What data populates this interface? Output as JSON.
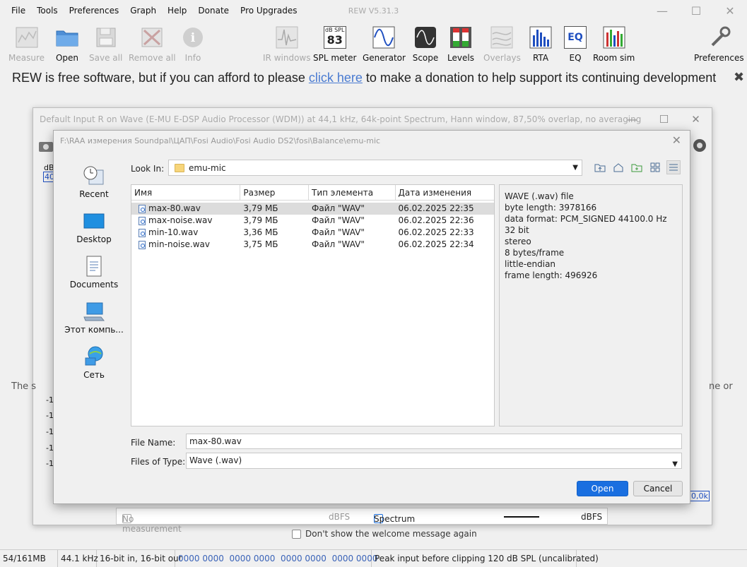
{
  "menu": [
    "File",
    "Tools",
    "Preferences",
    "Graph",
    "Help",
    "Donate",
    "Pro Upgrades"
  ],
  "app_title": "REW V5.31.3",
  "window_controls": [
    "—",
    "☐",
    "✕"
  ],
  "toolbar": {
    "measure": "Measure",
    "open": "Open",
    "save_all": "Save all",
    "remove_all": "Remove all",
    "info": "Info",
    "ir_windows": "IR windows",
    "spl_meter": "SPL meter",
    "spl_top": "dB SPL",
    "spl_value": "83",
    "generator": "Generator",
    "scope": "Scope",
    "levels": "Levels",
    "overlays": "Overlays",
    "rta": "RTA",
    "eq": "EQ",
    "eq_icon_text": "EQ",
    "room_sim": "Room sim",
    "preferences": "Preferences"
  },
  "donation": {
    "before": "REW is free software, but if you can afford to please ",
    "link": "click here",
    "after": " to make a donation to help support its continuing development",
    "close": "✖"
  },
  "bg_window": {
    "title": "Default Input R on Wave (E-MU E-DSP Audio Processor (WDM)) at 44,1 kHz, 64k-point Spectrum, Hann window, 87,50% overlap, no averaging",
    "controls": [
      "—",
      "☐",
      "✕"
    ],
    "db_label": "dB",
    "db_value": "40",
    "right_label": "0,0k",
    "status": {
      "no_measurement": "No measurement",
      "dbfs1": "dBFS",
      "spectrum": "Spectrum",
      "dbfs2": "dBFS"
    },
    "axis_ticks": [
      "-1",
      "-1",
      "-1",
      "-1",
      "-1"
    ]
  },
  "welcome_left": "The s",
  "welcome_right": "ne or",
  "dont_show": "Don't show the welcome message again",
  "dialog": {
    "title": "F:\\RAA измерения Soundpal\\ЦАП\\Fosi Audio\\Fosi Audio DS2\\fosi\\Balance\\emu-mic",
    "close": "✕",
    "places": [
      {
        "label": "Recent"
      },
      {
        "label": "Desktop"
      },
      {
        "label": "Documents"
      },
      {
        "label": "Этот компь..."
      },
      {
        "label": "Сеть"
      }
    ],
    "look_in_label": "Look In:",
    "look_in_value": "emu-mic",
    "columns": [
      "Имя",
      "Размер",
      "Тип элемента",
      "Дата изменения"
    ],
    "files": [
      {
        "name": "max-80.wav",
        "size": "3,79 МБ",
        "type": "Файл \"WAV\"",
        "date": "06.02.2025 22:35"
      },
      {
        "name": "max-noise.wav",
        "size": "3,79 МБ",
        "type": "Файл \"WAV\"",
        "date": "06.02.2025 22:36"
      },
      {
        "name": "min-10.wav",
        "size": "3,36 МБ",
        "type": "Файл \"WAV\"",
        "date": "06.02.2025 22:33"
      },
      {
        "name": "min-noise.wav",
        "size": "3,75 МБ",
        "type": "Файл \"WAV\"",
        "date": "06.02.2025 22:34"
      }
    ],
    "info": [
      "WAVE (.wav) file",
      "byte length: 3978166",
      "data format: PCM_SIGNED 44100.0 Hz",
      "32 bit",
      "stereo",
      "8 bytes/frame",
      "little-endian",
      "frame length: 496926"
    ],
    "file_name_label": "File Name:",
    "file_name_value": "max-80.wav",
    "files_of_type_label": "Files of Type:",
    "files_of_type_value": "Wave (.wav)",
    "open_button": "Open",
    "cancel_button": "Cancel"
  },
  "statusbar": {
    "memory": "54/161MB",
    "rate": "44.1 kHz",
    "bits": "16-bit in, 16-bit out",
    "hex": "0000 0000  0000 0000  0000 0000  0000 0000",
    "peak": "Peak input before clipping 120 dB SPL (uncalibrated)"
  },
  "colors": {
    "accent": "#1a6fe0",
    "link": "#4a7bd1",
    "disabled": "#a9a9a9"
  }
}
